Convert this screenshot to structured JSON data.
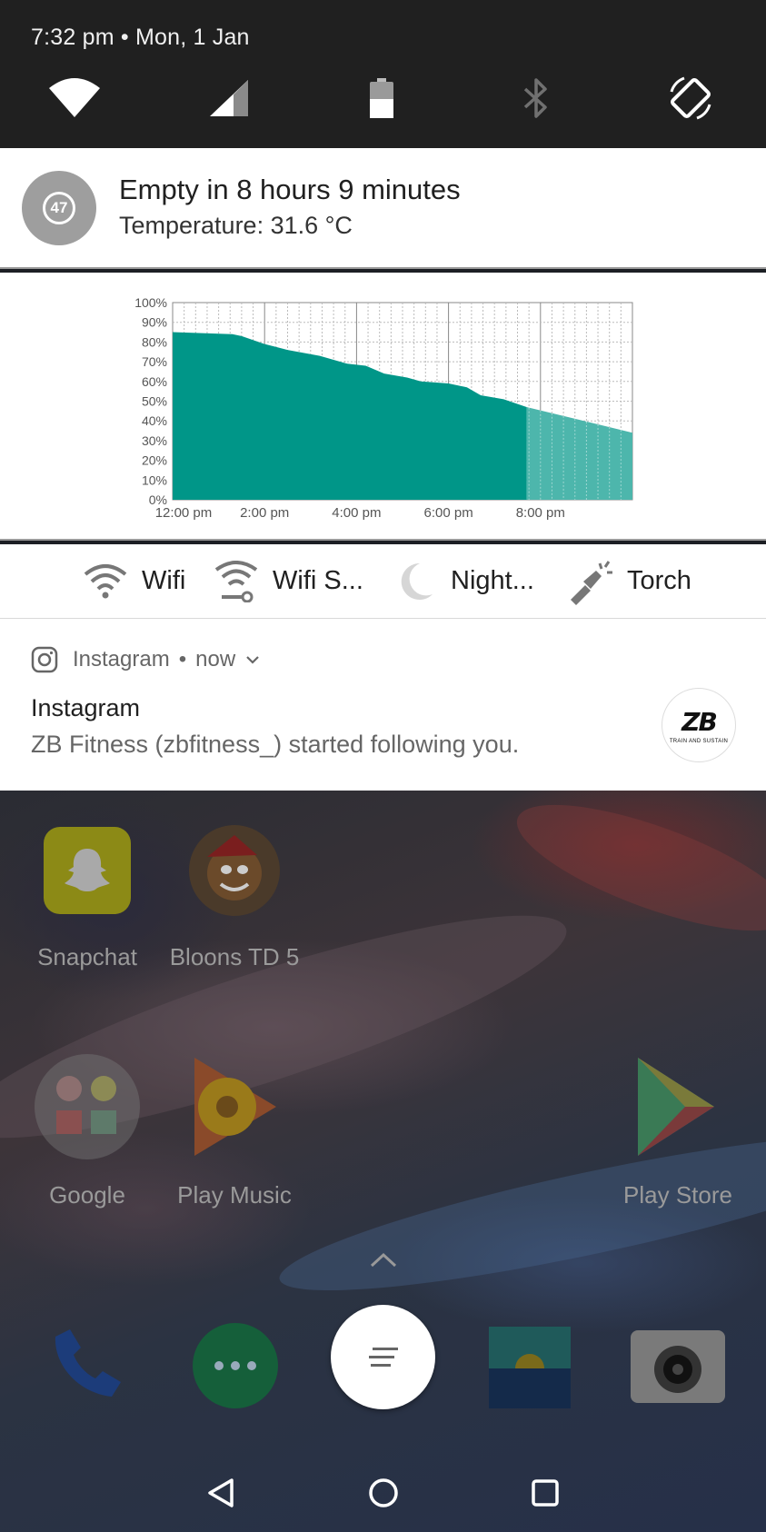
{
  "status": {
    "time_date": "7:32 pm • Mon, 1 Jan"
  },
  "quick_tiles": [
    {
      "icon": "wifi-icon"
    },
    {
      "icon": "cell-signal-icon"
    },
    {
      "icon": "battery-icon"
    },
    {
      "icon": "bluetooth-icon"
    },
    {
      "icon": "auto-rotate-icon"
    }
  ],
  "battery_notification": {
    "level": "47",
    "title": "Empty in 8 hours 9 minutes",
    "subtitle": "Temperature: 31.6 °C"
  },
  "chart_data": {
    "type": "area",
    "title": "",
    "xlabel": "",
    "ylabel": "",
    "x_ticks": [
      "12:00 pm",
      "2:00 pm",
      "4:00 pm",
      "6:00 pm",
      "8:00 pm"
    ],
    "y_ticks": [
      "0%",
      "10%",
      "20%",
      "30%",
      "40%",
      "50%",
      "60%",
      "70%",
      "80%",
      "90%",
      "100%"
    ],
    "x_range_hours": [
      0,
      10
    ],
    "ylim": [
      0,
      100
    ],
    "grid": true,
    "color": "#009688",
    "projection_color": "#4db6ac",
    "series": [
      {
        "x": [
          0,
          1.3,
          1.5,
          2.0,
          2.5,
          3.2,
          3.8,
          4.2,
          4.6,
          5.1,
          5.4,
          6.0,
          6.4,
          6.7,
          7.2,
          7.7
        ],
        "y": [
          85,
          84,
          83,
          79,
          76,
          73,
          69,
          68,
          64,
          62,
          60,
          59,
          57,
          53,
          51,
          47
        ]
      },
      {
        "x": [
          7.7,
          10.0
        ],
        "y": [
          47,
          34
        ]
      }
    ]
  },
  "shortcuts": [
    {
      "icon": "wifi-icon",
      "label": "Wifi"
    },
    {
      "icon": "wifi-settings-icon",
      "label": "Wifi S..."
    },
    {
      "icon": "moon-icon",
      "label": "Night..."
    },
    {
      "icon": "torch-icon",
      "label": "Torch"
    }
  ],
  "instagram_notification": {
    "app": "Instagram",
    "time": "now",
    "title": "Instagram",
    "text": "ZB Fitness (zbfitness_) started following you.",
    "avatar_text": "ZB",
    "avatar_tagline": "TRAIN AND SUSTAIN"
  },
  "home_apps": [
    {
      "name": "Snapchat"
    },
    {
      "name": "Bloons TD 5"
    },
    {
      "name": "Google"
    },
    {
      "name": "Play Music"
    },
    {
      "name": "Play Store"
    }
  ],
  "dock": [
    {
      "icon": "phone-icon"
    },
    {
      "icon": "messages-icon"
    },
    {
      "icon": "gallery-icon"
    },
    {
      "icon": "camera-icon"
    }
  ],
  "nav": [
    {
      "icon": "back-icon"
    },
    {
      "icon": "home-icon"
    },
    {
      "icon": "recents-icon"
    }
  ]
}
